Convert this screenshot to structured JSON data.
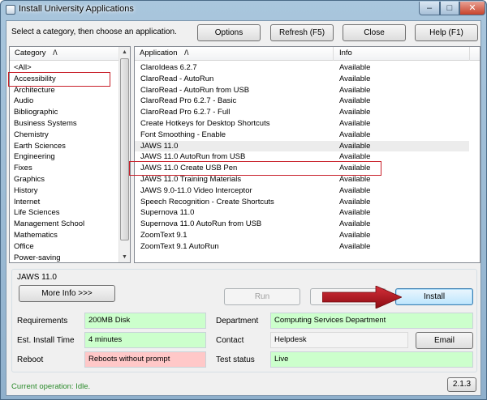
{
  "window": {
    "title": "Install University Applications"
  },
  "titlebar": {
    "minimize": "–",
    "maximize": "□",
    "close": "✕"
  },
  "toolbar": {
    "instruction": "Select a category, then choose an application.",
    "options": "Options",
    "refresh": "Refresh (F5)",
    "close": "Close",
    "help": "Help (F1)"
  },
  "categories": {
    "header": "Category",
    "sort_glyph": "/\\",
    "items": [
      "<All>",
      "Accessibility",
      "Architecture",
      "Audio",
      "Bibliographic",
      "Business Systems",
      "Chemistry",
      "Earth Sciences",
      "Engineering",
      "Fixes",
      "Graphics",
      "History",
      "Internet",
      "Life Sciences",
      "Management School",
      "Mathematics",
      "Office",
      "Power-saving"
    ]
  },
  "applications": {
    "header_app": "Application",
    "header_info": "Info",
    "sort_glyph": "/\\",
    "rows": [
      {
        "name": "ClaroIdeas 6.2.7",
        "info": "Available"
      },
      {
        "name": "ClaroRead - AutoRun",
        "info": "Available"
      },
      {
        "name": "ClaroRead - AutoRun from USB",
        "info": "Available"
      },
      {
        "name": "ClaroRead Pro 6.2.7 - Basic",
        "info": "Available"
      },
      {
        "name": "ClaroRead Pro 6.2.7 - Full",
        "info": "Available"
      },
      {
        "name": "Create Hotkeys for Desktop Shortcuts",
        "info": "Available"
      },
      {
        "name": "Font Smoothing - Enable",
        "info": "Available"
      },
      {
        "name": "JAWS 11.0",
        "info": "Available"
      },
      {
        "name": "JAWS 11.0 AutoRun from USB",
        "info": "Available"
      },
      {
        "name": "JAWS 11.0 Create USB Pen",
        "info": "Available"
      },
      {
        "name": "JAWS 11.0 Training Materials",
        "info": "Available"
      },
      {
        "name": "JAWS 9.0-11.0 Video Interceptor",
        "info": "Available"
      },
      {
        "name": "Speech Recognition - Create Shortcuts",
        "info": "Available"
      },
      {
        "name": "Supernova 11.0",
        "info": "Available"
      },
      {
        "name": "Supernova 11.0 AutoRun from USB",
        "info": "Available"
      },
      {
        "name": "ZoomText 9.1",
        "info": "Available"
      },
      {
        "name": "ZoomText 9.1 AutoRun",
        "info": "Available"
      }
    ]
  },
  "details": {
    "selected_app": "JAWS 11.0",
    "more_info": "More Info >>>",
    "run": "Run",
    "install": "Install",
    "requirements_label": "Requirements",
    "requirements_value": "200MB Disk",
    "install_time_label": "Est. Install Time",
    "install_time_value": "4 minutes",
    "reboot_label": "Reboot",
    "reboot_value": "Reboots without prompt",
    "department_label": "Department",
    "department_value": "Computing Services Department",
    "contact_label": "Contact",
    "contact_value": "Helpdesk",
    "email": "Email",
    "test_status_label": "Test status",
    "test_status_value": "Live"
  },
  "status": {
    "text": "Current operation: Idle.",
    "version": "2.1.3"
  },
  "colors": {
    "highlight_box": "#c8202a",
    "arrow": "#b0121b",
    "green_field": "#ccffcc",
    "red_field": "#ffc8c8",
    "status_text": "#2a8a2a"
  }
}
